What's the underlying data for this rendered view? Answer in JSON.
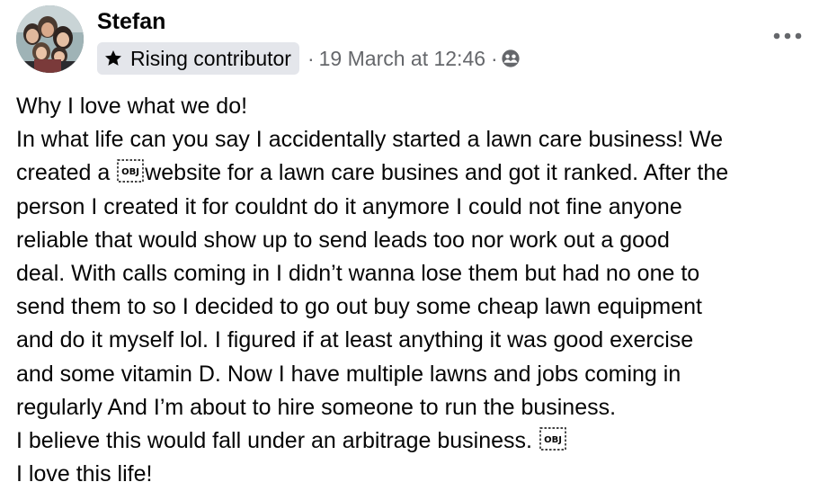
{
  "author": {
    "name": "Stefan",
    "badge": "Rising contributor",
    "badge_icon": "star-icon"
  },
  "meta": {
    "separator": "·",
    "timestamp": "19 March at 12:46",
    "audience_icon": "friends-icon"
  },
  "actions": {
    "more_icon": "more-options-icon"
  },
  "post": {
    "line1": "Why I love what we do!",
    "line2": "In what life can you say I accidentally started a lawn care business! We",
    "line3_before": "created a",
    "line3_after": "website for a lawn care busines and got it ranked. After the",
    "line4": "person I created it for couldnt do it anymore I could not fine anyone",
    "line5": "reliable that would show up to send leads too nor work out a good",
    "line6": "deal. With calls coming in I didn’t wanna lose them but had no one to",
    "line7": "send them to so I decided to go out buy some cheap lawn equipment",
    "line8": "and do it myself lol. I figured if at least anything it was good exercise",
    "line9": "and some vitamin D. Now I have multiple lawns and jobs coming in",
    "line10": "regularly And I’m about to hire someone to run the business.",
    "line11": "I believe this would fall under an arbitrage business.",
    "line12": "I love this life!",
    "object_glyph": "OBJ"
  }
}
